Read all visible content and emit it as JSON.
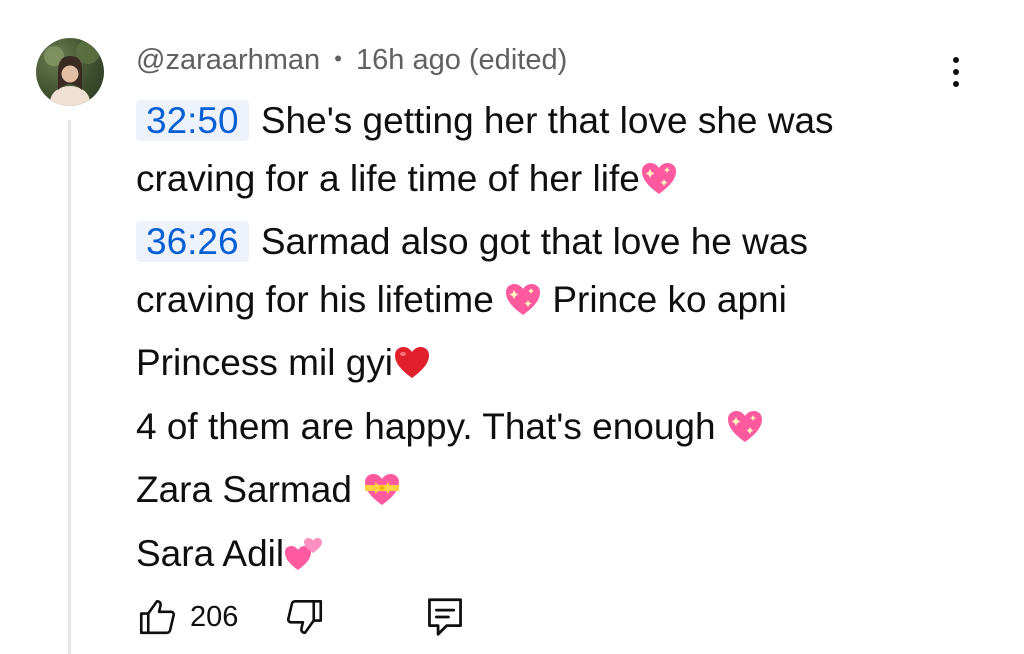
{
  "comment": {
    "author": "@zaraarhman",
    "separator": "•",
    "time": "16h ago (edited)",
    "avatar_icon": "user-avatar-photo",
    "lines": [
      {
        "timestamp": "32:50",
        "text": "She's getting her that love she was"
      },
      {
        "text": "craving for a life time of her life",
        "emoji": "sparkling-heart"
      },
      {
        "timestamp": "36:26",
        "text": "Sarmad also got that love he was"
      },
      {
        "text": "craving for his lifetime ",
        "emoji": "sparkling-heart",
        "text_after": " Prince ko apni"
      },
      {
        "text": "Princess mil gyi",
        "emoji": "red-heart"
      },
      {
        "text": "4 of them are happy. That's enough ",
        "emoji": "sparkling-heart"
      },
      {
        "text": "Zara Sarmad ",
        "emoji": "heart-with-ribbon"
      },
      {
        "text": "Sara Adil",
        "emoji": "two-hearts"
      }
    ],
    "likes": "206"
  },
  "icons": {
    "menu": "more-vert-icon",
    "like": "thumb-up-icon",
    "dislike": "thumb-down-icon",
    "reply": "reply-comment-icon"
  },
  "colors": {
    "timestamp_link": "#065fd4",
    "timestamp_bg": "#eef3fb",
    "meta_text": "#606060",
    "heart_pink": "#ff5aa0",
    "heart_red": "#e0202a"
  }
}
